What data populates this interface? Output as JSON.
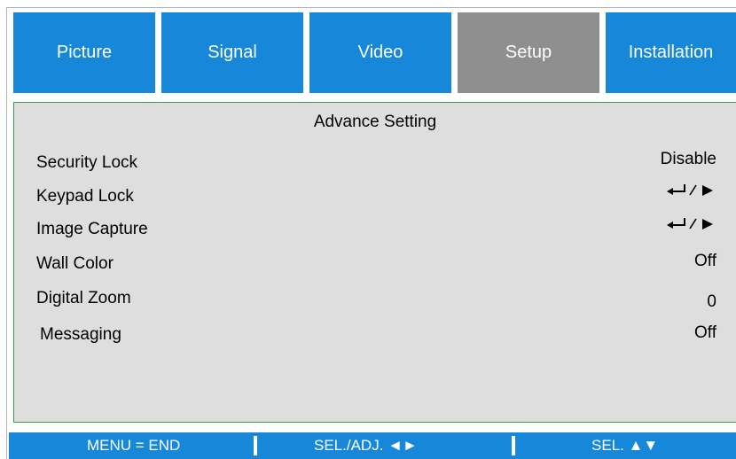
{
  "tabs": [
    {
      "label": "Picture",
      "active": false
    },
    {
      "label": "Signal",
      "active": false
    },
    {
      "label": "Video",
      "active": false
    },
    {
      "label": "Setup",
      "active": true
    },
    {
      "label": "Installation",
      "active": false
    }
  ],
  "panel": {
    "title": "Advance Setting",
    "rows": [
      {
        "label": "Security Lock",
        "value": "Disable"
      },
      {
        "label": "Keypad Lock",
        "value_icon": "enter-right-icon"
      },
      {
        "label": "Image Capture",
        "value_icon": "enter-right-icon"
      },
      {
        "label": "Wall Color",
        "value": "Off"
      },
      {
        "label": "Digital Zoom",
        "value": "0"
      },
      {
        "label": "Messaging",
        "value": "Off"
      }
    ]
  },
  "footer": {
    "menu_end": "MENU = END",
    "sel_adj": "SEL./ADJ. ◄►",
    "sel": "SEL. ▲▼"
  },
  "colors": {
    "tab_blue": "#1787d9",
    "tab_active_gray": "#8f8f8f",
    "panel_bg": "#dedede",
    "panel_border_green": "#3e9a5a",
    "footer_blue": "#1787d9"
  }
}
